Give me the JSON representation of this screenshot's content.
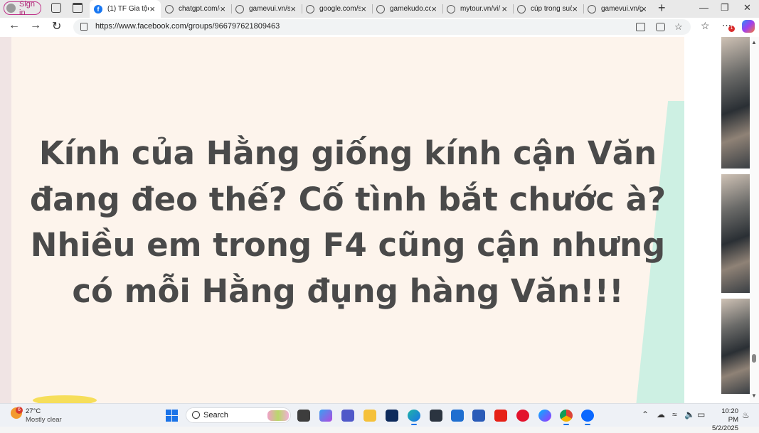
{
  "browser": {
    "sign_in_label": "Sign in",
    "tabs": [
      {
        "title": "(1) TF Gia tộc F",
        "favicon": "facebook-icon",
        "active": true
      },
      {
        "title": "chatgpt.com/c/",
        "favicon": "globe-icon",
        "active": false
      },
      {
        "title": "gamevui.vn/sa",
        "favicon": "globe-icon",
        "active": false
      },
      {
        "title": "google.com/se",
        "favicon": "globe-icon",
        "active": false
      },
      {
        "title": "gamekudo.com",
        "favicon": "globe-icon",
        "active": false
      },
      {
        "title": "mytour.vn/vi/",
        "favicon": "globe-icon",
        "active": false
      },
      {
        "title": "cúp trong suốt",
        "favicon": "globe-icon",
        "active": false
      },
      {
        "title": "gamevui.vn/ga",
        "favicon": "globe-icon",
        "active": false
      }
    ],
    "new_tab_symbol": "+",
    "url": "https://www.facebook.com/groups/966797621809463",
    "notification_badge": "1"
  },
  "post": {
    "caption_lines": [
      "Kính của Hằng giống kính cận Văn",
      "đang đeo thế? Cố tình bắt chước à?",
      "Nhiều em trong F4 cũng cận nhưng",
      "có mỗi Hằng đụng hàng Văn!!!"
    ],
    "background_color": "#fdf4ec",
    "text_color": "#4a4a4a"
  },
  "taskbar": {
    "weather": {
      "badge": "6",
      "temp": "27°C",
      "condition": "Mostly clear"
    },
    "search_placeholder": "Search",
    "apps": [
      "file-explorer-icon",
      "copilot-icon",
      "teams-icon",
      "folder-icon",
      "dropbox-icon",
      "edge-icon",
      "amazon-icon",
      "mail-icon",
      "store-icon",
      "youtube-icon",
      "opera-icon",
      "messenger-icon",
      "chrome-icon",
      "zalo-icon"
    ],
    "clock_time": "10:20 PM",
    "clock_date": "5/2/2025"
  },
  "colors": {
    "accent": "#1877f2",
    "taskbar_accent": "#1a73e8"
  }
}
